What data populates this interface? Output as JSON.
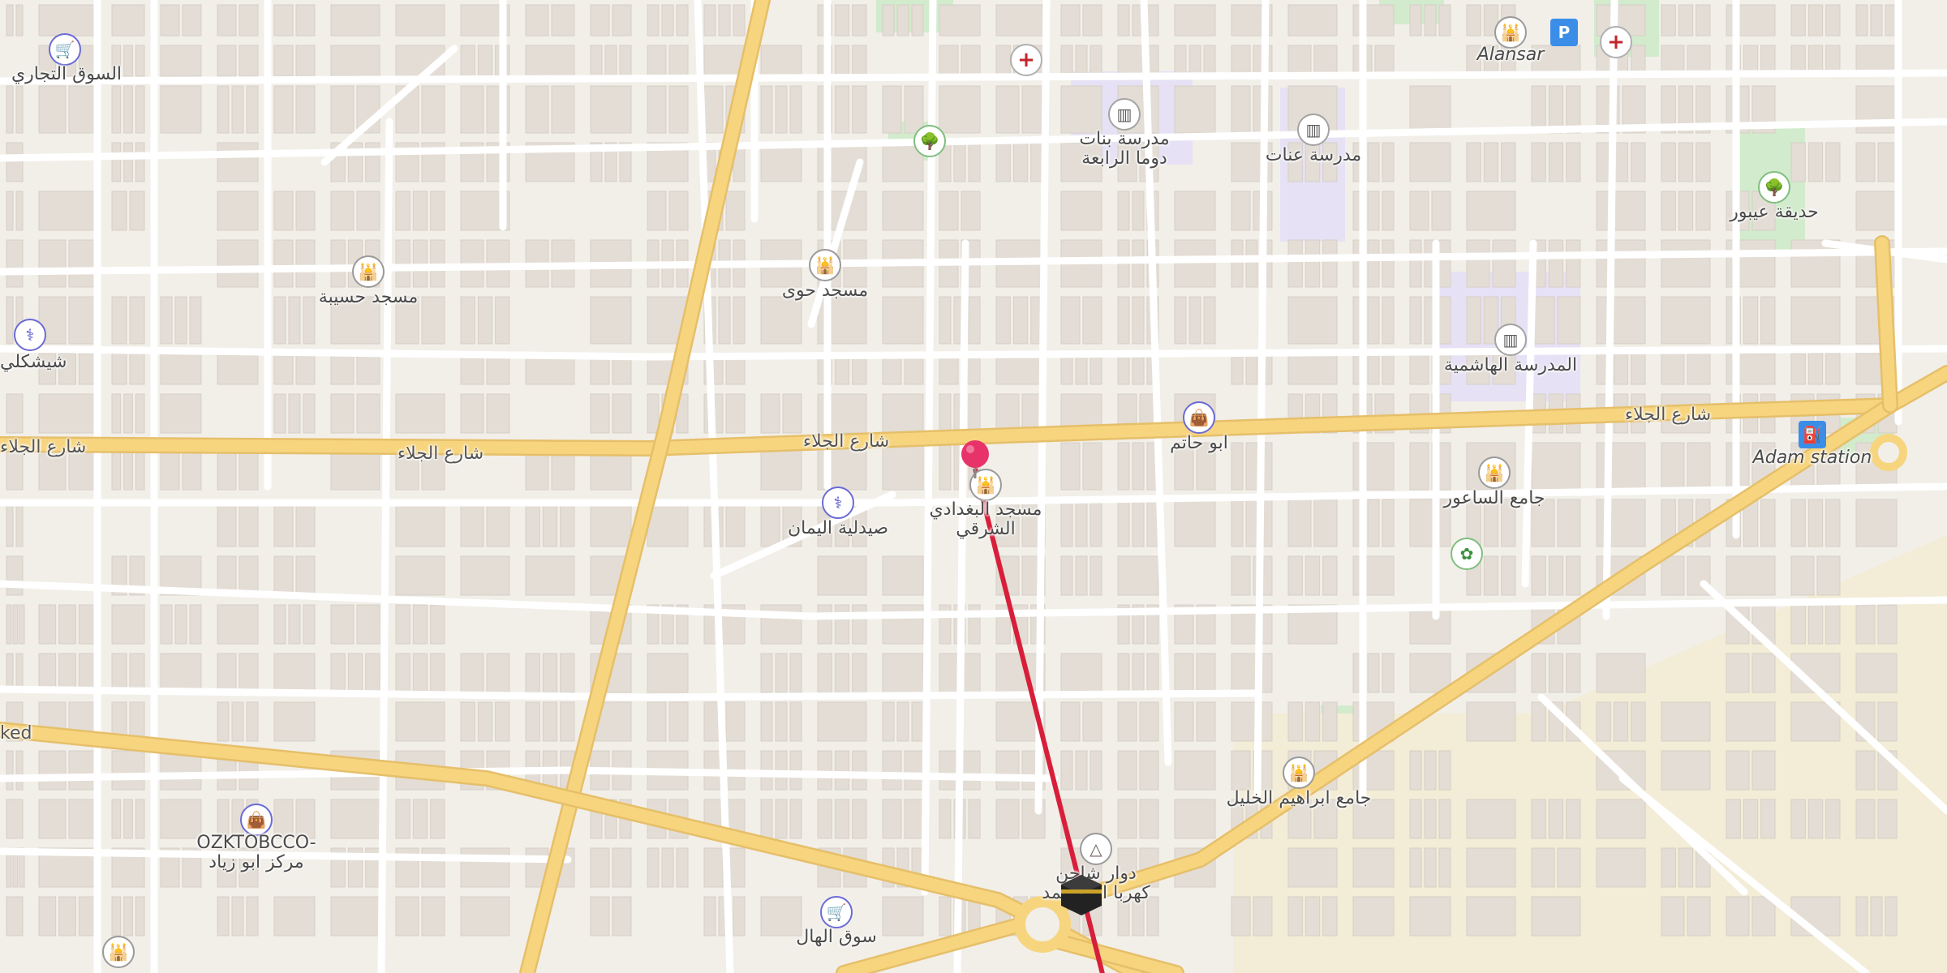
{
  "map": {
    "colors": {
      "background": "#f2efe9",
      "building": "#e3ddd5",
      "minor_road": "#ffffff",
      "major_road": "#f7d57f",
      "route_line": "#d81e3a",
      "pin": "#e8336a",
      "school_area": "#e6e1f5",
      "park": "#d2ebcc"
    },
    "roads": [
      {
        "name": "شارع الجلاء"
      },
      {
        "name": "شارع الجلاء"
      },
      {
        "name": "شارع الجلاء"
      },
      {
        "name": "شارع الجلاء"
      },
      {
        "name": "ked"
      }
    ],
    "places": [
      {
        "name": "السوق التجاري",
        "icon": "cart-icon",
        "kind": "shop"
      },
      {
        "name": "Alansar",
        "icon": "mosque-icon",
        "kind": "poi"
      },
      {
        "name": "مدرسة بنات\nدوما الرابعة",
        "icon": "school-icon",
        "kind": "school"
      },
      {
        "name": "مدرسة عنات",
        "icon": "school-icon",
        "kind": "school"
      },
      {
        "name": "حديقة عيبور",
        "icon": "tree-icon",
        "kind": "park"
      },
      {
        "name": "مسجد حسيبة",
        "icon": "mosque-icon",
        "kind": "poi"
      },
      {
        "name": "مسجد حوى",
        "icon": "mosque-icon",
        "kind": "poi"
      },
      {
        "name": "شيشكلي",
        "icon": "pharmacy-icon",
        "kind": "shop"
      },
      {
        "name": "المدرسة الهاشمية",
        "icon": "school-icon",
        "kind": "school"
      },
      {
        "name": "ابو حاتم",
        "icon": "shopping-bag-icon",
        "kind": "shop"
      },
      {
        "name": "Adam station",
        "icon": "fuel-icon",
        "kind": "sq"
      },
      {
        "name": "مسجد البغدادي\nالشرقي",
        "icon": "mosque-icon",
        "kind": "poi"
      },
      {
        "name": "صيدلية اليمان",
        "icon": "pharmacy-icon",
        "kind": "shop"
      },
      {
        "name": "جامع الساعور",
        "icon": "mosque-icon",
        "kind": "poi"
      },
      {
        "name": "جامع ابراهيم الخليل",
        "icon": "mosque-icon",
        "kind": "poi"
      },
      {
        "name": "OZKTOBCCO-\nمركز ابو زياد",
        "icon": "shopping-bag-icon",
        "kind": "shop"
      },
      {
        "name": "دوار شاحن\nكهربا ابو محمد",
        "icon": "monument-icon",
        "kind": "poi"
      },
      {
        "name": "سوق الهال",
        "icon": "cart-icon",
        "kind": "shop"
      }
    ],
    "markers": [
      {
        "name": "destination-pin",
        "icon": "pin-icon"
      },
      {
        "name": "kaaba-marker",
        "icon": "kaaba-icon"
      }
    ],
    "extra_icons": [
      {
        "icon": "parking-icon"
      },
      {
        "icon": "hospital-icon"
      },
      {
        "icon": "hospital-icon"
      },
      {
        "icon": "tree-icon"
      },
      {
        "icon": "garden-icon"
      },
      {
        "icon": "mosque-icon"
      }
    ]
  }
}
